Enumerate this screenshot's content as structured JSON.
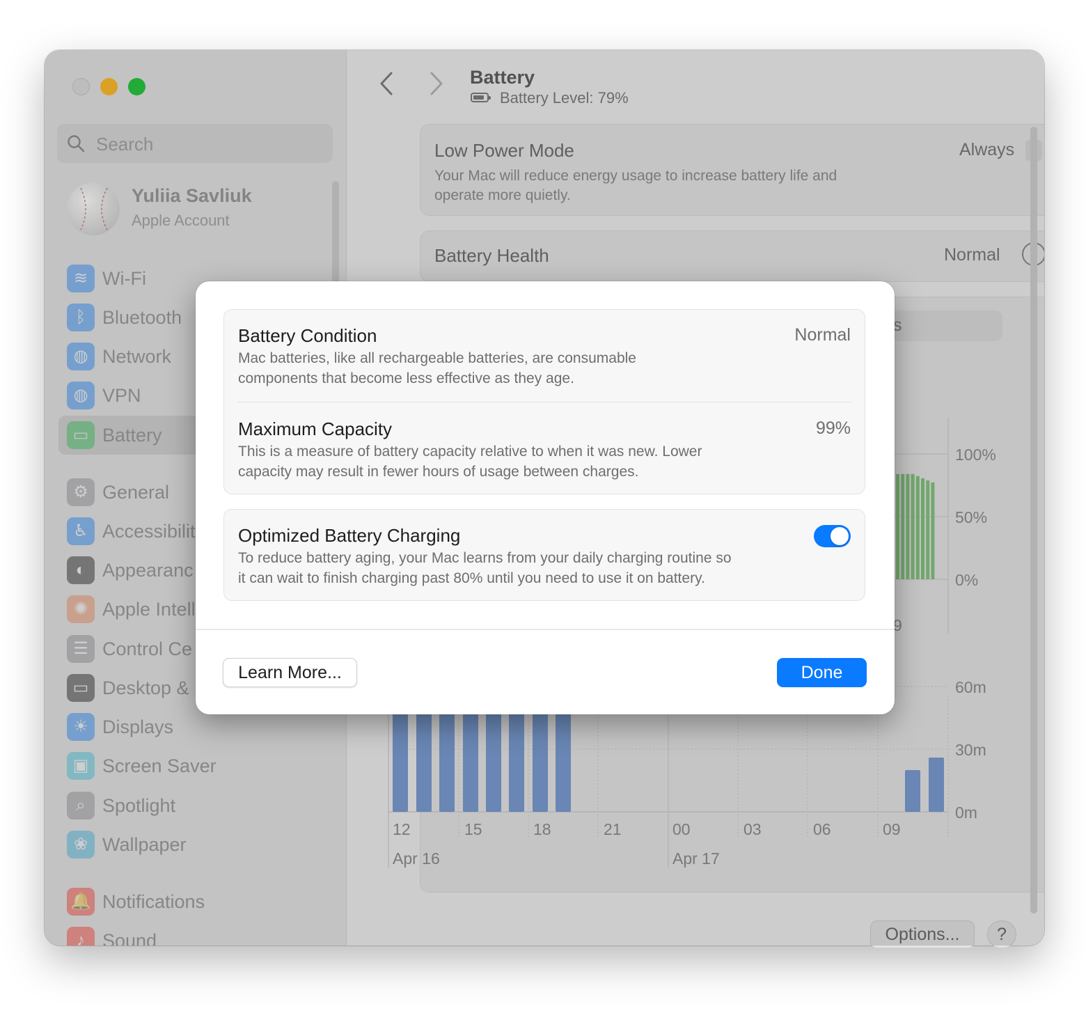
{
  "colors": {
    "accent": "#0a7aff",
    "usage_bar": "#7b9dd2",
    "charge_bar": "#85c47f",
    "traffic_min": "#febc2e",
    "traffic_max": "#28c840"
  },
  "sidebar": {
    "search_placeholder": "Search",
    "account": {
      "name": "Yuliia Savliuk",
      "subtitle": "Apple Account"
    },
    "items": [
      {
        "label": "Wi-Fi",
        "icon": "wifi-icon",
        "color": "#1e88ff"
      },
      {
        "label": "Bluetooth",
        "icon": "bluetooth-icon",
        "color": "#1e88ff"
      },
      {
        "label": "Network",
        "icon": "globe-icon",
        "color": "#1e88ff"
      },
      {
        "label": "VPN",
        "icon": "vpn-globe-icon",
        "color": "#1e88ff"
      },
      {
        "label": "Battery",
        "icon": "battery-icon",
        "color": "#34c759",
        "selected": true
      },
      {
        "label": "General",
        "icon": "gear-icon",
        "color": "#8e8e93"
      },
      {
        "label": "Accessibilit",
        "icon": "accessibility-icon",
        "color": "#1e88ff"
      },
      {
        "label": "Appearanc",
        "icon": "appearance-icon",
        "color": "#1d1d1f"
      },
      {
        "label": "Apple Intell",
        "icon": "apple-intelligence-icon",
        "color": "#f08a5d"
      },
      {
        "label": "Control Ce",
        "icon": "control-center-icon",
        "color": "#8e8e93"
      },
      {
        "label": "Desktop &",
        "icon": "desktop-dock-icon",
        "color": "#1d1d1f"
      },
      {
        "label": "Displays",
        "icon": "sun-icon",
        "color": "#1e88ff"
      },
      {
        "label": "Screen Saver",
        "icon": "screen-saver-icon",
        "color": "#3fc8e4"
      },
      {
        "label": "Spotlight",
        "icon": "spotlight-icon",
        "color": "#8e8e93"
      },
      {
        "label": "Wallpaper",
        "icon": "wallpaper-icon",
        "color": "#3fb5e8"
      },
      {
        "label": "Notifications",
        "icon": "bell-icon",
        "color": "#ff3b30"
      },
      {
        "label": "Sound",
        "icon": "speaker-icon",
        "color": "#ff3b30"
      }
    ]
  },
  "header": {
    "title": "Battery",
    "battery_level": "Battery Level: 79%"
  },
  "low_power": {
    "title": "Low Power Mode",
    "value": "Always",
    "description_line1": "Your Mac will reduce energy usage to increase battery life and",
    "description_line2": "operate more quietly."
  },
  "battery_health": {
    "title": "Battery Health",
    "value": "Normal"
  },
  "tab_fragment": "s",
  "chart_fragment_label": "9",
  "options_label": "Options...",
  "help_label": "?",
  "chart_data": [
    {
      "type": "bar",
      "description_source": "battery level (partially visible, right part)",
      "ylim": [
        0,
        100
      ],
      "ytick_labels": [
        "100%",
        "50%",
        "0%"
      ],
      "values": [
        100,
        100,
        100,
        100,
        98,
        96,
        94,
        92
      ]
    },
    {
      "type": "bar",
      "ytick_labels": [
        "60m",
        "30m",
        "0m"
      ],
      "ylim": [
        0,
        60
      ],
      "xtick_labels": [
        "12",
        "15",
        "18",
        "21",
        "00",
        "03",
        "06",
        "09"
      ],
      "date_labels": [
        "Apr 16",
        "Apr 17"
      ],
      "x": [
        "12:00",
        "13:00",
        "14:00",
        "15:00",
        "16:00",
        "17:00",
        "18:00",
        "19:00",
        "10:00",
        "11:00"
      ],
      "values": [
        60,
        60,
        60,
        60,
        60,
        60,
        60,
        60,
        20,
        26
      ]
    }
  ],
  "dialog": {
    "condition": {
      "title": "Battery Condition",
      "value": "Normal",
      "description_line1": "Mac batteries, like all rechargeable batteries, are consumable",
      "description_line2": "components that become less effective as they age."
    },
    "capacity": {
      "title": "Maximum Capacity",
      "value": "99%",
      "description_line1": "This is a measure of battery capacity relative to when it was new. Lower",
      "description_line2": "capacity may result in fewer hours of usage between charges."
    },
    "optimized": {
      "title": "Optimized Battery Charging",
      "enabled": true,
      "description_line1": "To reduce battery aging, your Mac learns from your daily charging routine so",
      "description_line2": "it can wait to finish charging past 80% until you need to use it on battery."
    },
    "learn_more_label": "Learn More...",
    "done_label": "Done"
  }
}
